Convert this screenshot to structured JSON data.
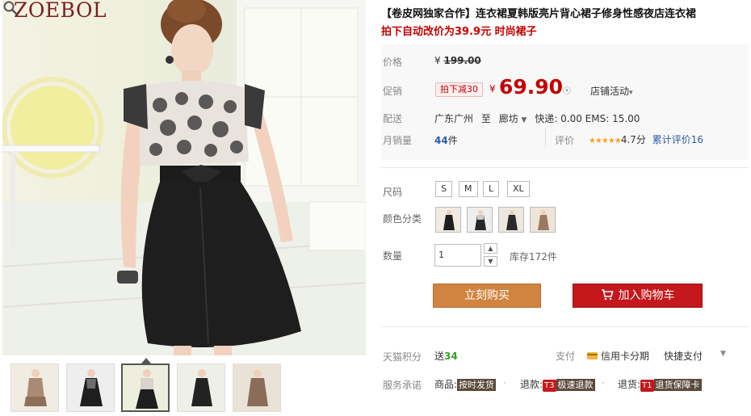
{
  "gallery": {
    "brand": "ZOEBOL",
    "zoom_icon": "magnifier-icon",
    "thumbnail_count": 5,
    "active_thumbnail": 3
  },
  "product": {
    "title": "【卷皮网独家合作】连衣裙夏韩版亮片背心裙子修身性感夜店连衣裙",
    "subtitle": "拍下自动改价为39.9元 时尚裙子"
  },
  "price": {
    "label": "价格",
    "currency": "¥",
    "original": "199.00"
  },
  "promo": {
    "label": "促销",
    "tag": "拍下减30",
    "currency": "¥",
    "price": "69.90",
    "shop_activity": "店铺活动"
  },
  "shipping": {
    "label": "配送",
    "from": "广东广州",
    "to_word": "至",
    "to": "廊坊",
    "fees": "快递: 0.00 EMS: 15.00"
  },
  "sales": {
    "label": "月销量",
    "count": "44",
    "unit": "件",
    "rating_label": "评价",
    "stars": "★★★★★",
    "score": "4.7分",
    "reviews": "累计评价16"
  },
  "options": {
    "size_label": "尺码",
    "sizes": [
      "S",
      "M",
      "L",
      "XL"
    ],
    "color_label": "颜色分类",
    "color_count": 4
  },
  "quantity": {
    "label": "数量",
    "value": "1",
    "up": "▲",
    "down": "▼",
    "stock": "库存172件"
  },
  "actions": {
    "buy": "立刻购买",
    "cart": "加入购物车"
  },
  "footer": {
    "points_label": "天猫积分",
    "points_prefix": "送",
    "points_value": "34",
    "pay_label": "支付",
    "credit": "信用卡分期",
    "quick_pay": "快捷支付",
    "service_label": "服务承诺",
    "goods_label": "商品:",
    "goods_badge": "按时发货",
    "return_label": "退款:",
    "return_tag": "T3",
    "return_badge": "极速退款",
    "refund_label": "退货:",
    "refund_tag": "T1",
    "refund_badge": "退货保障卡"
  },
  "colors": {
    "accent_red": "#c40000",
    "buy_orange": "#d08440",
    "cart_red": "#c4181c",
    "count_blue": "#2a5caa",
    "points_green": "#3c9b2e"
  }
}
